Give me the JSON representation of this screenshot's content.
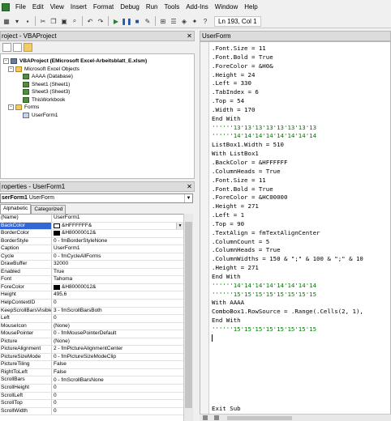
{
  "menubar": {
    "items": [
      "File",
      "Edit",
      "View",
      "Insert",
      "Format",
      "Debug",
      "Run",
      "Tools",
      "Add-Ins",
      "Window",
      "Help"
    ]
  },
  "toolbar": {
    "position_text": "Ln 193, Col 1",
    "icons": [
      "save-icon",
      "cut-icon",
      "copy-icon",
      "paste-icon",
      "find-icon",
      "undo-icon",
      "redo-icon",
      "run-icon",
      "break-icon",
      "reset-icon",
      "design-mode-icon",
      "project-explorer-icon",
      "properties-icon",
      "object-browser-icon",
      "toolbox-icon",
      "help-icon"
    ]
  },
  "project": {
    "title": "roject - VBAProject",
    "tree": [
      {
        "label": "VBAProject (EMicrosoft Excel-Arbeitsblatt_E.xlsm)",
        "level": 0,
        "icon": "project-icon",
        "bold": true,
        "expander": "-"
      },
      {
        "label": "Microsoft Excel Objects",
        "level": 1,
        "icon": "folder-icon",
        "bold": false,
        "expander": "-"
      },
      {
        "label": "AAAA (Database)",
        "level": 2,
        "icon": "sheet-icon",
        "bold": false,
        "expander": ""
      },
      {
        "label": "Sheet1 (Sheet1)",
        "level": 2,
        "icon": "sheet-icon",
        "bold": false,
        "expander": ""
      },
      {
        "label": "Sheet3 (Sheet3)",
        "level": 2,
        "icon": "sheet-icon",
        "bold": false,
        "expander": ""
      },
      {
        "label": "ThisWorkbook",
        "level": 2,
        "icon": "workbook-icon",
        "bold": false,
        "expander": ""
      },
      {
        "label": "Forms",
        "level": 1,
        "icon": "folder-icon",
        "bold": false,
        "expander": "-"
      },
      {
        "label": "UserForm1",
        "level": 2,
        "icon": "form-icon",
        "bold": false,
        "expander": ""
      }
    ]
  },
  "properties": {
    "title": "roperties - UserForm1",
    "object_name": "serForm1",
    "object_type": "UserForm",
    "tabs": [
      "Alphabetic",
      "Categorized"
    ],
    "active_tab": "Alphabetic",
    "rows": [
      {
        "name": "(Name)",
        "value": "UserForm1",
        "swatch": "",
        "selected": false
      },
      {
        "name": "BackColor",
        "value": "&HFFFFFF&",
        "swatch": "#FFFFFF",
        "selected": true
      },
      {
        "name": "BorderColor",
        "value": "&H80000012&",
        "swatch": "#000000",
        "selected": false
      },
      {
        "name": "BorderStyle",
        "value": "0 - fmBorderStyleNone",
        "swatch": "",
        "selected": false
      },
      {
        "name": "Caption",
        "value": "UserForm1",
        "swatch": "",
        "selected": false
      },
      {
        "name": "Cycle",
        "value": "0 - fmCycleAllForms",
        "swatch": "",
        "selected": false
      },
      {
        "name": "DrawBuffer",
        "value": "32000",
        "swatch": "",
        "selected": false
      },
      {
        "name": "Enabled",
        "value": "True",
        "swatch": "",
        "selected": false
      },
      {
        "name": "Font",
        "value": "Tahoma",
        "swatch": "",
        "selected": false
      },
      {
        "name": "ForeColor",
        "value": "&H80000012&",
        "swatch": "#000000",
        "selected": false
      },
      {
        "name": "Height",
        "value": "495,6",
        "swatch": "",
        "selected": false
      },
      {
        "name": "HelpContextID",
        "value": "0",
        "swatch": "",
        "selected": false
      },
      {
        "name": "KeepScrollBarsVisible",
        "value": "3 - fmScrollBarsBoth",
        "swatch": "",
        "selected": false
      },
      {
        "name": "Left",
        "value": "0",
        "swatch": "",
        "selected": false
      },
      {
        "name": "MouseIcon",
        "value": "(None)",
        "swatch": "",
        "selected": false
      },
      {
        "name": "MousePointer",
        "value": "0 - fmMousePointerDefault",
        "swatch": "",
        "selected": false
      },
      {
        "name": "Picture",
        "value": "(None)",
        "swatch": "",
        "selected": false
      },
      {
        "name": "PictureAlignment",
        "value": "2 - fmPictureAlignmentCenter",
        "swatch": "",
        "selected": false
      },
      {
        "name": "PictureSizeMode",
        "value": "0 - fmPictureSizeModeClip",
        "swatch": "",
        "selected": false
      },
      {
        "name": "PictureTiling",
        "value": "False",
        "swatch": "",
        "selected": false
      },
      {
        "name": "RightToLeft",
        "value": "False",
        "swatch": "",
        "selected": false
      },
      {
        "name": "ScrollBars",
        "value": "0 - fmScrollBarsNone",
        "swatch": "",
        "selected": false
      },
      {
        "name": "ScrollHeight",
        "value": "0",
        "swatch": "",
        "selected": false
      },
      {
        "name": "ScrollLeft",
        "value": "0",
        "swatch": "",
        "selected": false
      },
      {
        "name": "ScrollTop",
        "value": "0",
        "swatch": "",
        "selected": false
      },
      {
        "name": "ScrollWidth",
        "value": "0",
        "swatch": "",
        "selected": false
      }
    ]
  },
  "code": {
    "title": "UserForm",
    "comment_color": "#007A00",
    "lines": [
      {
        "text": ".Font.Size = 11",
        "comment": false
      },
      {
        "text": ".Font.Bold = True",
        "comment": false
      },
      {
        "text": ".ForeColor = &H0&",
        "comment": false
      },
      {
        "text": ".Height = 24",
        "comment": false
      },
      {
        "text": ".Left = 330",
        "comment": false
      },
      {
        "text": ".TabIndex = 6",
        "comment": false
      },
      {
        "text": ".Top = 54",
        "comment": false
      },
      {
        "text": ".Width = 170",
        "comment": false
      },
      {
        "text": "End With",
        "comment": false
      },
      {
        "text": "''''''13'13'13'13'13'13'13'13",
        "comment": true
      },
      {
        "text": "''''''14'14'14'14'14'14'14'14",
        "comment": true
      },
      {
        "text": "ListBox1.Width = 510",
        "comment": false
      },
      {
        "text": "With ListBox1",
        "comment": false
      },
      {
        "text": ".BackColor = &HFFFFFF",
        "comment": false
      },
      {
        "text": ".ColumnHeads = True",
        "comment": false
      },
      {
        "text": ".Font.Size = 11",
        "comment": false
      },
      {
        "text": ".Font.Bold = True",
        "comment": false
      },
      {
        "text": ".ForeColor = &HC00000",
        "comment": false
      },
      {
        "text": ".Height = 271",
        "comment": false
      },
      {
        "text": ".Left = 1",
        "comment": false
      },
      {
        "text": ".Top = 90",
        "comment": false
      },
      {
        "text": ".TextAlign = fmTextAlignCenter",
        "comment": false
      },
      {
        "text": ".ColumnCount = 5",
        "comment": false
      },
      {
        "text": ".ColumnHeads = True",
        "comment": false
      },
      {
        "text": ".ColumnWidths = 150 & \";\" & 100 & \";\" & 10",
        "comment": false
      },
      {
        "text": ".Height = 271",
        "comment": false
      },
      {
        "text": "End With",
        "comment": false
      },
      {
        "text": "''''''14'14'14'14'14'14'14'14",
        "comment": true
      },
      {
        "text": "''''''15'15'15'15'15'15'15'15",
        "comment": true
      },
      {
        "text": "With AAAA",
        "comment": false
      },
      {
        "text": "ComboBox1.RowSource = .Range(.Cells(2, 1),",
        "comment": false
      },
      {
        "text": "End With",
        "comment": false
      },
      {
        "text": "''''''15'15'15'15'15'15'15'15",
        "comment": true
      },
      {
        "text": "|",
        "comment": false
      },
      {
        "text": "",
        "comment": false
      },
      {
        "text": "",
        "comment": false
      },
      {
        "text": "",
        "comment": false
      },
      {
        "text": "",
        "comment": false
      },
      {
        "text": "",
        "comment": false
      },
      {
        "text": "",
        "comment": false
      },
      {
        "text": "",
        "comment": false
      },
      {
        "text": "Exit Sub",
        "comment": false
      },
      {
        "text": "EERR:",
        "comment": false
      },
      {
        "text": "  ''''''1111111111111111111111",
        "comment": true
      }
    ]
  }
}
